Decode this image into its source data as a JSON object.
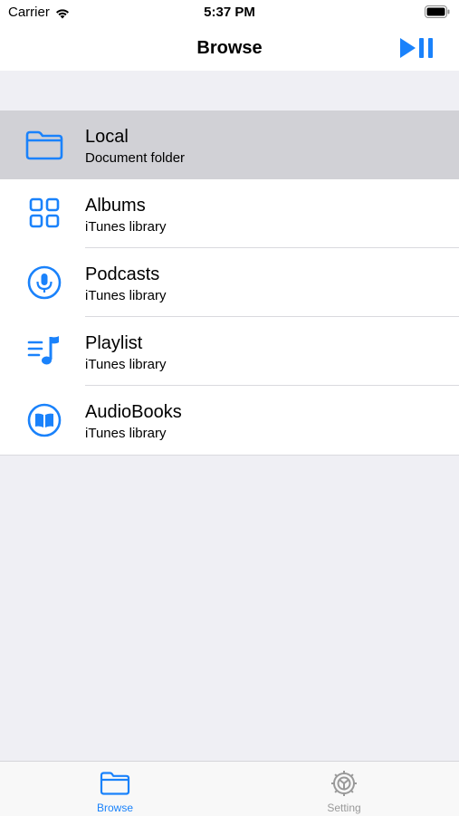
{
  "status_bar": {
    "carrier": "Carrier",
    "time": "5:37 PM"
  },
  "nav": {
    "title": "Browse",
    "right_button_icon": "play-pause-icon"
  },
  "colors": {
    "accent": "#1A82FB",
    "selected_row": "#D1D1D6",
    "background": "#EFEFF4",
    "inactive_tab": "#999999"
  },
  "list": {
    "items": [
      {
        "title": "Local",
        "subtitle": "Document folder",
        "icon": "folder-icon",
        "selected": true
      },
      {
        "title": "Albums",
        "subtitle": "iTunes library",
        "icon": "albums-grid-icon",
        "selected": false
      },
      {
        "title": "Podcasts",
        "subtitle": "iTunes library",
        "icon": "podcast-mic-icon",
        "selected": false
      },
      {
        "title": "Playlist",
        "subtitle": "iTunes library",
        "icon": "playlist-icon",
        "selected": false
      },
      {
        "title": "AudioBooks",
        "subtitle": "iTunes library",
        "icon": "audiobook-icon",
        "selected": false
      }
    ]
  },
  "tab_bar": {
    "tabs": [
      {
        "label": "Browse",
        "icon": "folder-icon",
        "active": true
      },
      {
        "label": "Setting",
        "icon": "gear-icon",
        "active": false
      }
    ]
  }
}
